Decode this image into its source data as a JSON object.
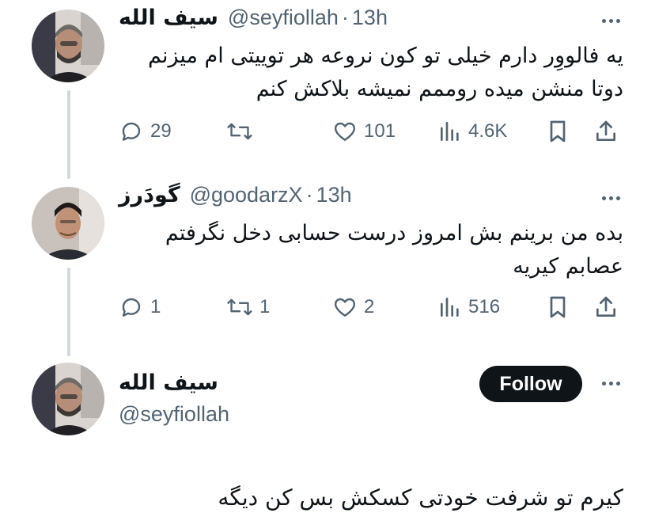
{
  "tweets": [
    {
      "display_name": "سیف الله",
      "handle": "@seyfiollah",
      "time": "13h",
      "text_lines": [
        "یه فالووِر دارم خیلی تو کون نروعه هر توییتی ام میزنم",
        "دوتا منشن میده روممم نمیشه بلاکش کنم"
      ],
      "replies": "29",
      "retweets": "",
      "likes": "101",
      "views": "4.6K"
    },
    {
      "display_name": "گودَرز",
      "handle": "@goodarzX",
      "time": "13h",
      "text_lines": [
        "بده من برینم بش امروز درست حسابی دخل نگرفتم",
        "عصابم کیریه"
      ],
      "replies": "1",
      "retweets": "1",
      "likes": "2",
      "views": "516"
    }
  ],
  "main_tweet": {
    "display_name": "سیف الله",
    "handle": "@seyfiollah",
    "follow_label": "Follow",
    "text": "کیرم تو شرفت خودتی کسکش بس کن دیگه"
  },
  "icons": {
    "reply": "speech-bubble-icon",
    "retweet": "retweet-icon",
    "like": "heart-icon",
    "views": "bar-chart-icon",
    "bookmark": "bookmark-icon",
    "share": "share-icon",
    "more": "more-dots-icon"
  },
  "colors": {
    "text": "#0f1419",
    "secondary": "#536471",
    "thread_line": "#cfd9de",
    "follow_bg": "#0f1419"
  }
}
